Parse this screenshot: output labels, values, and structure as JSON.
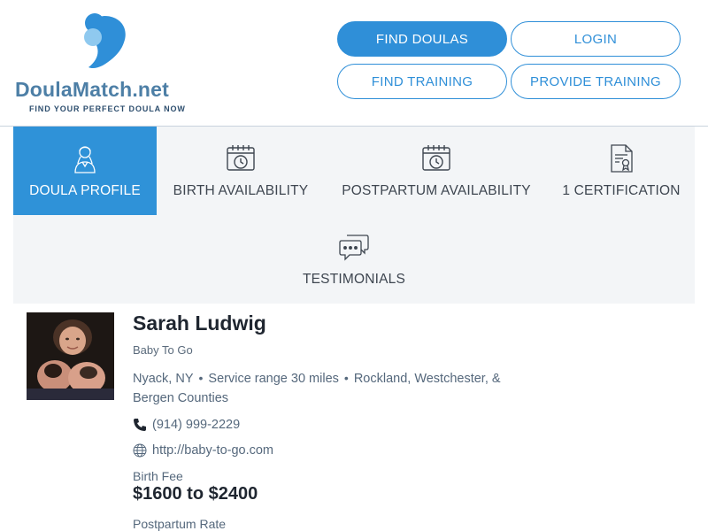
{
  "logo": {
    "name_main": "DoulaMatch",
    "name_suffix": ".net",
    "tagline": "FIND YOUR PERFECT DOULA NOW"
  },
  "nav": {
    "find_doulas": "FIND DOULAS",
    "login": "LOGIN",
    "find_training": "FIND TRAINING",
    "provide_training": "PROVIDE TRAINING"
  },
  "tabs": [
    {
      "label": "DOULA PROFILE",
      "icon": "doula-profile-icon",
      "active": true
    },
    {
      "label": "BIRTH AVAILABILITY",
      "icon": "calendar-clock-icon",
      "active": false
    },
    {
      "label": "POSTPARTUM AVAILABILITY",
      "icon": "calendar-clock-icon",
      "active": false
    },
    {
      "label": "1 CERTIFICATION",
      "icon": "certificate-icon",
      "active": false
    },
    {
      "label": "TESTIMONIALS",
      "icon": "chat-bubbles-icon",
      "active": false
    }
  ],
  "profile": {
    "name": "Sarah Ludwig",
    "business": "Baby To Go",
    "city": "Nyack, NY",
    "service_range": "Service range 30 miles",
    "areas": "Rockland, Westchester, & Bergen Counties",
    "phone": "(914) 999-2229",
    "website": "http://baby-to-go.com",
    "birth_fee_label": "Birth Fee",
    "birth_fee_value": "$1600 to $2400",
    "postpartum_label": "Postpartum Rate"
  },
  "colors": {
    "accent": "#2f8fd8",
    "logo_text": "#4d7fa6",
    "tab_bg": "#f3f5f7",
    "heading": "#1f2630"
  }
}
